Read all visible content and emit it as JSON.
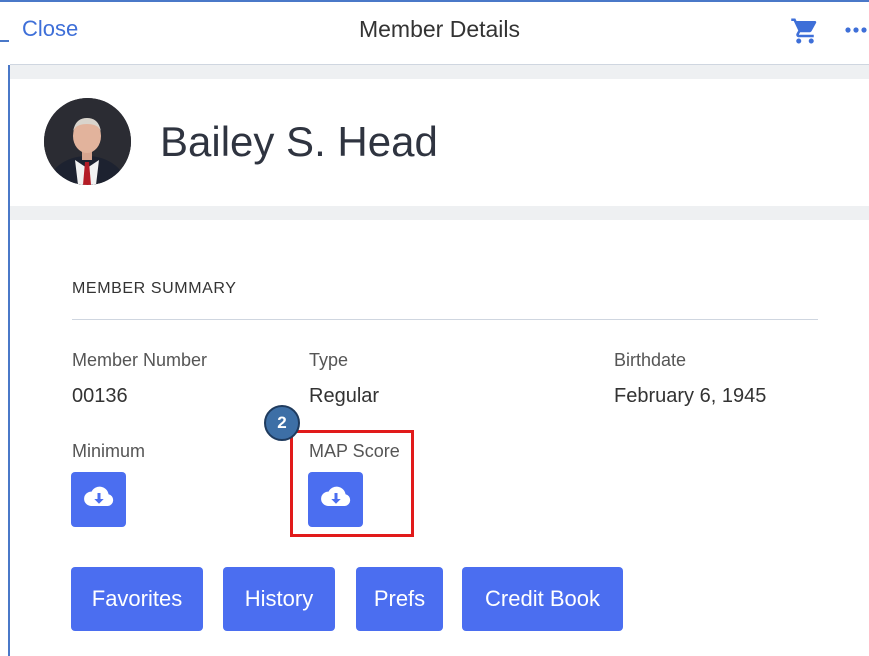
{
  "header": {
    "close_label": "Close",
    "title": "Member Details",
    "cart_icon": "shopping-cart-icon",
    "more_icon": "more-horizontal-icon"
  },
  "profile": {
    "name": "Bailey S. Head",
    "avatar": "member-photo"
  },
  "summary": {
    "title": "MEMBER SUMMARY",
    "member_number_label": "Member Number",
    "member_number_value": "00136",
    "type_label": "Type",
    "type_value": "Regular",
    "birthdate_label": "Birthdate",
    "birthdate_value": "February 6, 1945",
    "minimum_label": "Minimum",
    "map_score_label": "MAP Score",
    "download_icon": "cloud-download-icon"
  },
  "callout": {
    "step_number": "2",
    "highlight_color": "#e11a1a"
  },
  "actions": {
    "favorites": "Favorites",
    "history": "History",
    "prefs": "Prefs",
    "credit_book": "Credit Book"
  },
  "colors": {
    "accent": "#4b6ef0",
    "link": "#3e6fd8"
  }
}
